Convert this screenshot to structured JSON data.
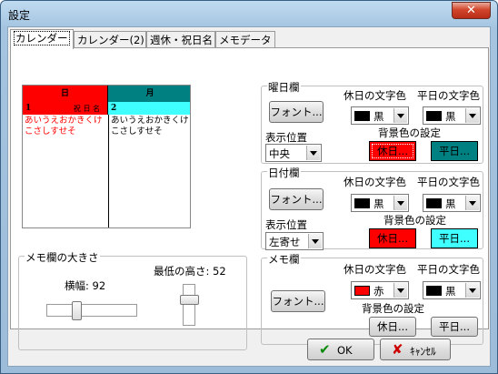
{
  "window": {
    "title": "設定",
    "close_glyph": "✕"
  },
  "tabs": [
    {
      "label": "カレンダー"
    },
    {
      "label": "カレンダー(2)"
    },
    {
      "label": "週休・祝日名"
    },
    {
      "label": "メモデータ"
    }
  ],
  "preview": {
    "sun_header": "日",
    "mon_header": "月",
    "sun_date": "1",
    "sun_holiday": "祝 日 名",
    "mon_date": "2",
    "sun_memo": "あいうえおかきくけこさしすせそ",
    "mon_memo": "あいうえおかきくけこさしすせそ"
  },
  "memo_size": {
    "label": "メモ欄の大きさ",
    "width_label": "横幅: 92",
    "min_height_label": "最低の高さ: 52"
  },
  "youbi": {
    "label": "曜日欄",
    "font_button": "フォント...",
    "holiday_text_color_label": "休日の文字色",
    "weekday_text_color_label": "平日の文字色",
    "holiday_color": {
      "name": "黒",
      "hex": "#000000"
    },
    "weekday_color": {
      "name": "黒",
      "hex": "#000000"
    },
    "position_label": "表示位置",
    "position_value": "中央",
    "bg_label": "背景色の設定",
    "holiday_bg_button": "休日...",
    "holiday_bg_hex": "#ff0000",
    "weekday_bg_button": "平日...",
    "weekday_bg_hex": "#008080"
  },
  "hizuke": {
    "label": "日付欄",
    "font_button": "フォント...",
    "holiday_text_color_label": "休日の文字色",
    "weekday_text_color_label": "平日の文字色",
    "holiday_color": {
      "name": "黒",
      "hex": "#000000"
    },
    "weekday_color": {
      "name": "黒",
      "hex": "#000000"
    },
    "position_label": "表示位置",
    "position_value": "左寄せ",
    "bg_label": "背景色の設定",
    "holiday_bg_button": "休日...",
    "holiday_bg_hex": "#ff0000",
    "weekday_bg_button": "平日...",
    "weekday_bg_hex": "#40ffff"
  },
  "memo": {
    "label": "メモ欄",
    "font_button": "フォント...",
    "holiday_text_color_label": "休日の文字色",
    "weekday_text_color_label": "平日の文字色",
    "holiday_color": {
      "name": "赤",
      "hex": "#ff0000"
    },
    "weekday_color": {
      "name": "黒",
      "hex": "#000000"
    },
    "bg_label": "背景色の設定",
    "holiday_bg_button": "休日...",
    "weekday_bg_button": "平日..."
  },
  "buttons": {
    "ok": "OK",
    "ok_icon": "✔",
    "cancel": "ｷｬﾝｾﾙ",
    "cancel_icon": "✘"
  }
}
